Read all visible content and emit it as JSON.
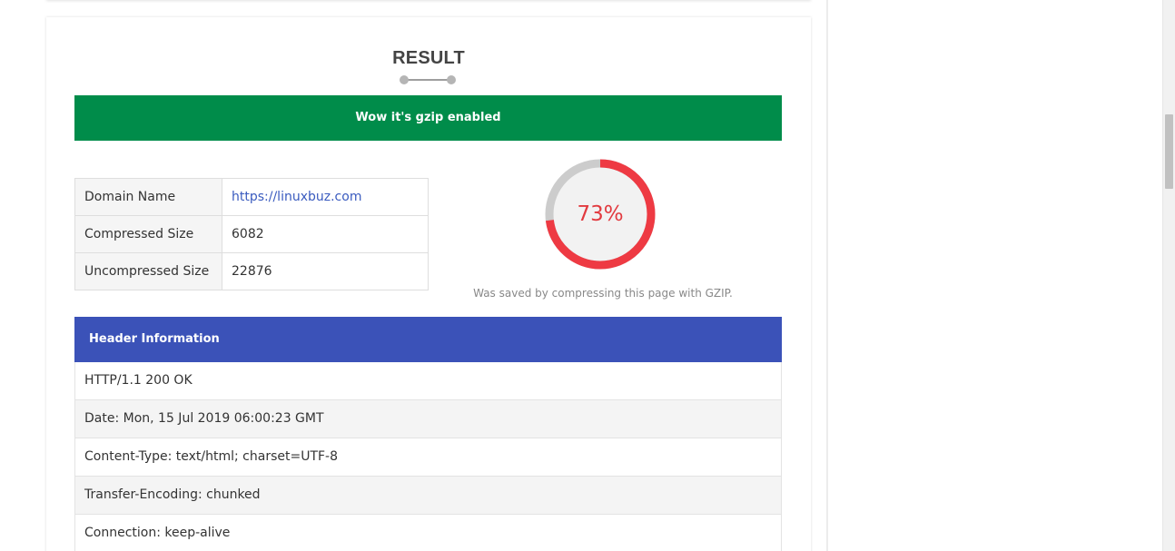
{
  "result": {
    "title": "RESULT",
    "banner": "Wow it's gzip enabled",
    "banner_color": "#008c4a"
  },
  "info": {
    "rows": [
      {
        "label": "Domain Name",
        "value": "https://linuxbuz.com"
      },
      {
        "label": "Compressed Size",
        "value": "6082"
      },
      {
        "label": "Uncompressed Size",
        "value": "22876"
      }
    ]
  },
  "gauge": {
    "percent": 73,
    "percent_label": "73%",
    "caption": "Was saved by compressing this page with GZIP.",
    "arc_color": "#ee3a43",
    "track_color": "#cccccc"
  },
  "headers": {
    "title": "Header Information",
    "panel_color": "#3b52b8",
    "rows": [
      "HTTP/1.1 200 OK",
      "Date: Mon, 15 Jul 2019 06:00:23 GMT",
      "Content-Type: text/html; charset=UTF-8",
      "Transfer-Encoding: chunked",
      "Connection: keep-alive"
    ]
  }
}
